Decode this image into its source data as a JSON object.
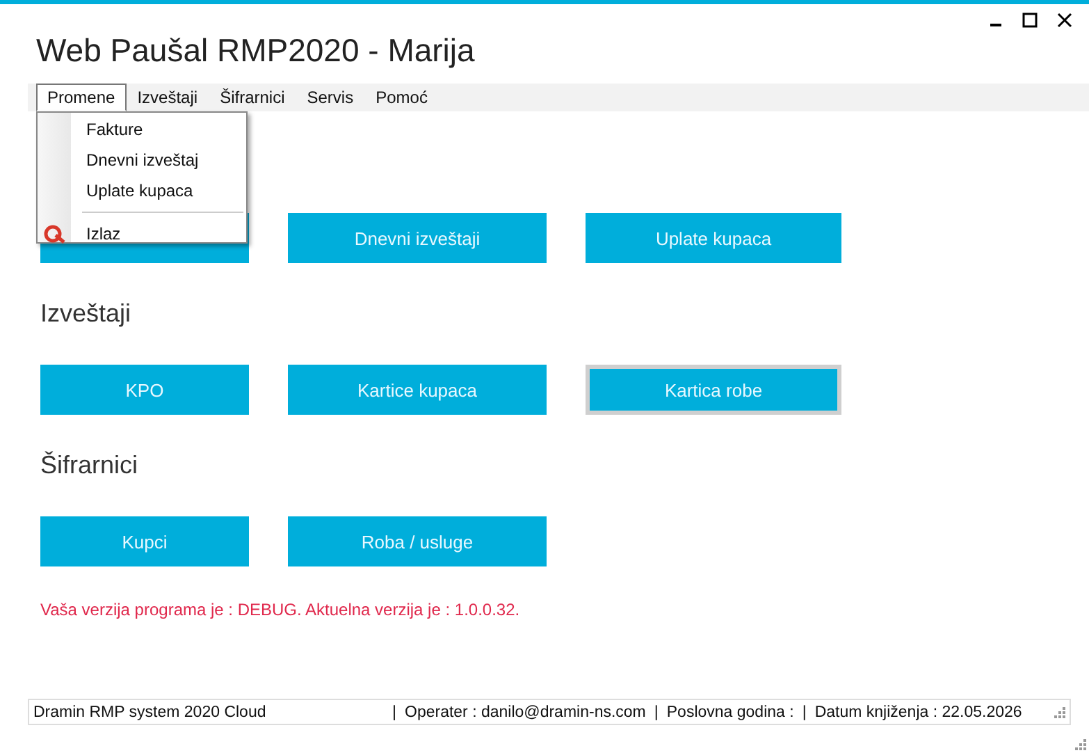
{
  "window": {
    "title": "Web Paušal RMP2020 - Marija"
  },
  "menu": [
    {
      "label": "Promene",
      "selected": true
    },
    {
      "label": "Izveštaji",
      "selected": false
    },
    {
      "label": "Šifrarnici",
      "selected": false
    },
    {
      "label": "Servis",
      "selected": false
    },
    {
      "label": "Pomoć",
      "selected": false
    }
  ],
  "dropdown": [
    {
      "kind": "item",
      "label": "Fakture"
    },
    {
      "kind": "item",
      "label": "Dnevni izveštaj"
    },
    {
      "kind": "item",
      "label": "Uplate kupaca"
    },
    {
      "kind": "separator"
    },
    {
      "kind": "item-with-icon",
      "label": "Izlaz"
    }
  ],
  "sections": [
    {
      "buttons": [
        {
          "focused": false
        },
        {
          "label": "Dnevni izveštaji",
          "focused": false
        },
        {
          "label": "Uplate kupaca",
          "focused": false
        }
      ]
    },
    {
      "heading": "Izveštaji",
      "buttons": [
        {
          "label": "KPO",
          "focused": false
        },
        {
          "label": "Kartice kupaca",
          "focused": false
        },
        {
          "label": "Kartica robe",
          "focused": true
        }
      ]
    },
    {
      "heading": "Šifrarnici",
      "buttons": [
        {
          "label": "Kupci",
          "focused": false
        },
        {
          "label": "Roba / usluge",
          "focused": false
        }
      ]
    }
  ],
  "version_notice": "Vaša verzija programa je : DEBUG. Aktuelna verzija je : 1.0.0.32.",
  "status_bar": [
    "Dramin RMP system 2020 Cloud",
    "|",
    "Operater : danilo@dramin-ns.com",
    "|",
    "Poslovna godina :",
    "|",
    "Datum knjiženja : 22.05.2026"
  ]
}
